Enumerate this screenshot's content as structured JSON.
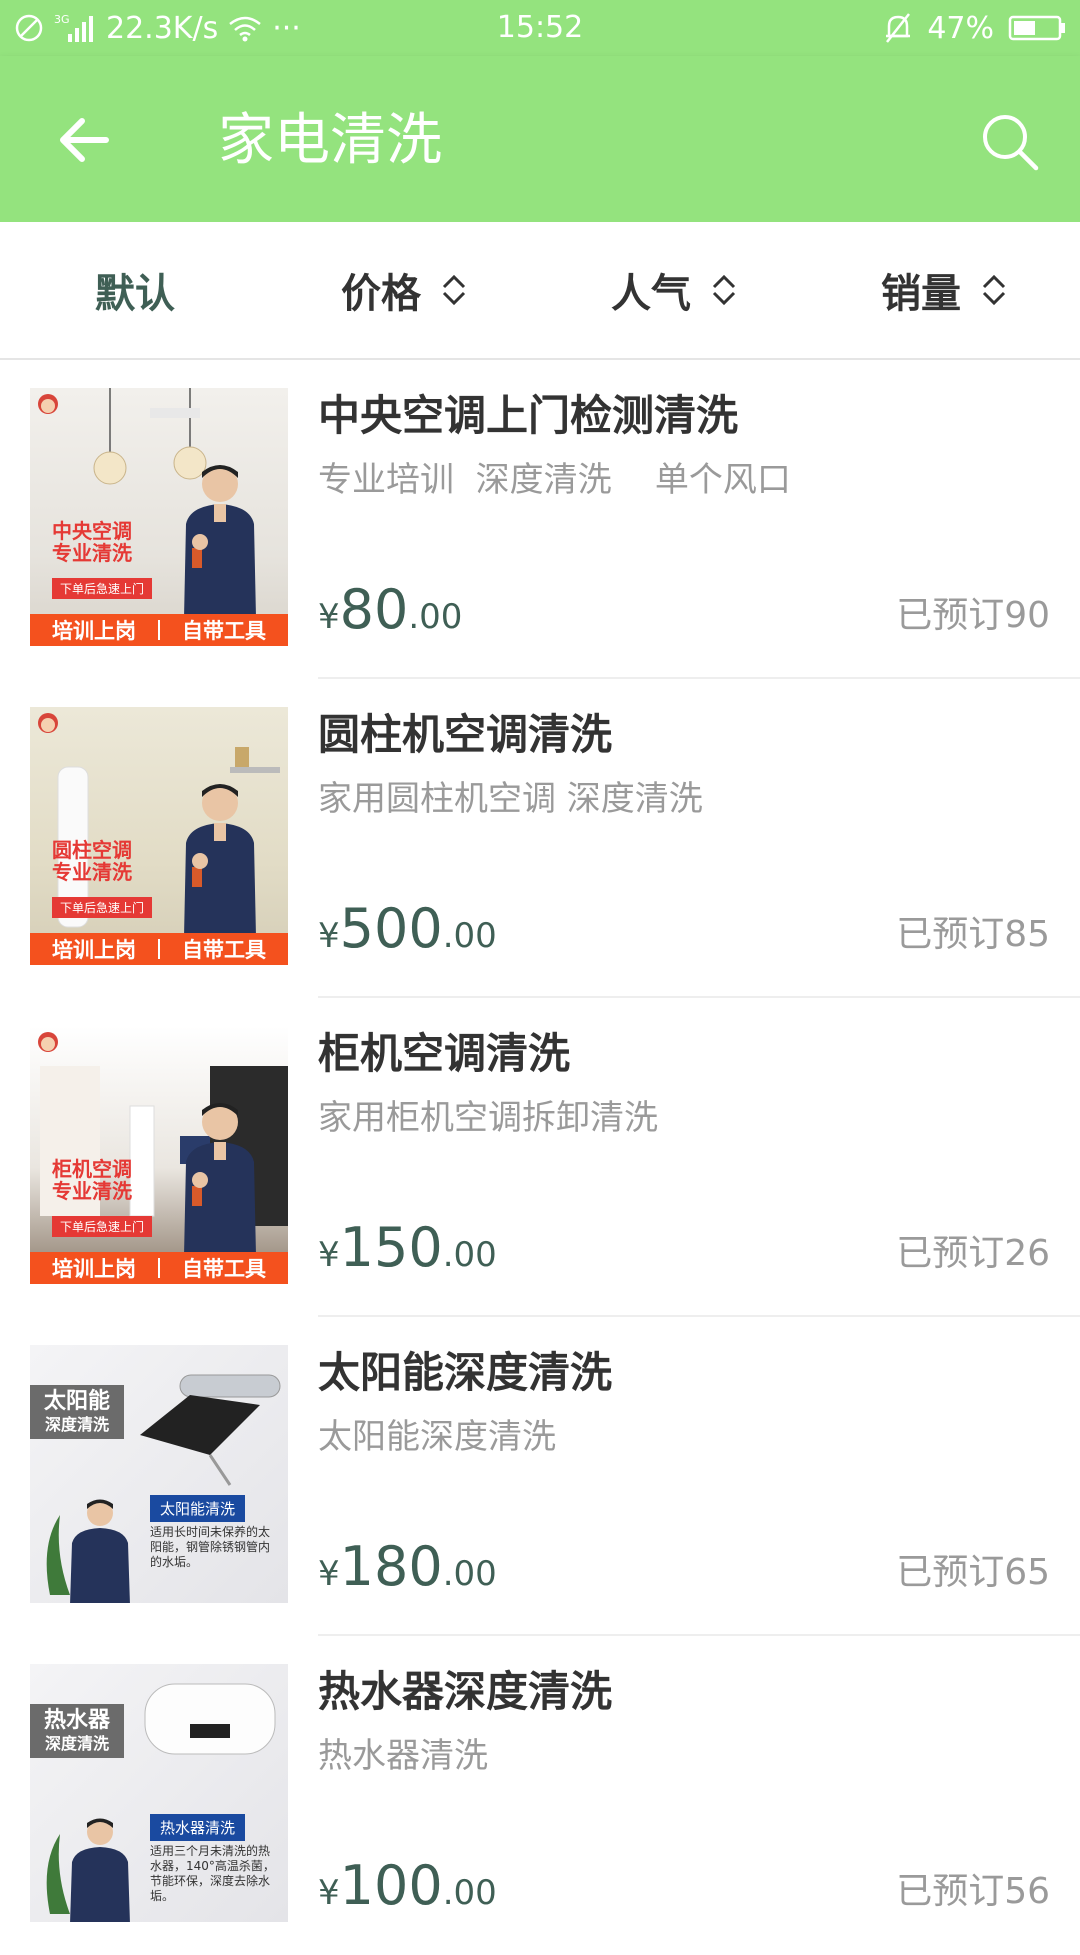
{
  "status_bar": {
    "network_label": "3G",
    "speed": "22.3K/s",
    "more": "···",
    "time": "15:52",
    "battery": "47%"
  },
  "header": {
    "title": "家电清洗"
  },
  "sort_bar": {
    "items": [
      {
        "label": "默认"
      },
      {
        "label": "价格"
      },
      {
        "label": "人气"
      },
      {
        "label": "销量"
      }
    ]
  },
  "products": [
    {
      "title": "中央空调上门检测清洗",
      "desc": "专业培训  深度清洗    单个风口",
      "price_currency": "¥",
      "price_int": "80",
      "price_dec": ".00",
      "booked": "已预订90",
      "thumb": {
        "big1": "中央空调",
        "big2": "专业清洗",
        "badge": "下单后急速上门",
        "stripe_left": "培训上岗",
        "stripe_right": "自带工具"
      }
    },
    {
      "title": "圆柱机空调清洗",
      "desc": "家用圆柱机空调 深度清洗",
      "price_currency": "¥",
      "price_int": "500",
      "price_dec": ".00",
      "booked": "已预订85",
      "thumb": {
        "big1": "圆柱空调",
        "big2": "专业清洗",
        "badge": "下单后急速上门",
        "stripe_left": "培训上岗",
        "stripe_right": "自带工具"
      }
    },
    {
      "title": "柜机空调清洗",
      "desc": "家用柜机空调拆卸清洗",
      "price_currency": "¥",
      "price_int": "150",
      "price_dec": ".00",
      "booked": "已预订26",
      "thumb": {
        "big1": "柜机空调",
        "big2": "专业清洗",
        "badge": "下单后急速上门",
        "stripe_left": "培训上岗",
        "stripe_right": "自带工具"
      }
    },
    {
      "title": "太阳能深度清洗",
      "desc": "太阳能深度清洗",
      "price_currency": "¥",
      "price_int": "180",
      "price_dec": ".00",
      "booked": "已预订65",
      "thumb": {
        "dark1": "太阳能",
        "dark2": "深度清洗",
        "tag": "太阳能清洗",
        "small": "适用长时间未保养的太阳能，钢管除锈钢管内的水垢。"
      }
    },
    {
      "title": "热水器深度清洗",
      "desc": "热水器清洗",
      "price_currency": "¥",
      "price_int": "100",
      "price_dec": ".00",
      "booked": "已预订56",
      "thumb": {
        "dark1": "热水器",
        "dark2": "深度清洗",
        "tag": "热水器清洗",
        "small": "适用三个月未清洗的热水器，140°高温杀菌，节能环保，深度去除水垢。"
      }
    }
  ],
  "colors": {
    "header_green": "#94e37e",
    "price_green": "#3f5f55",
    "stripe_orange": "#f4511e"
  }
}
